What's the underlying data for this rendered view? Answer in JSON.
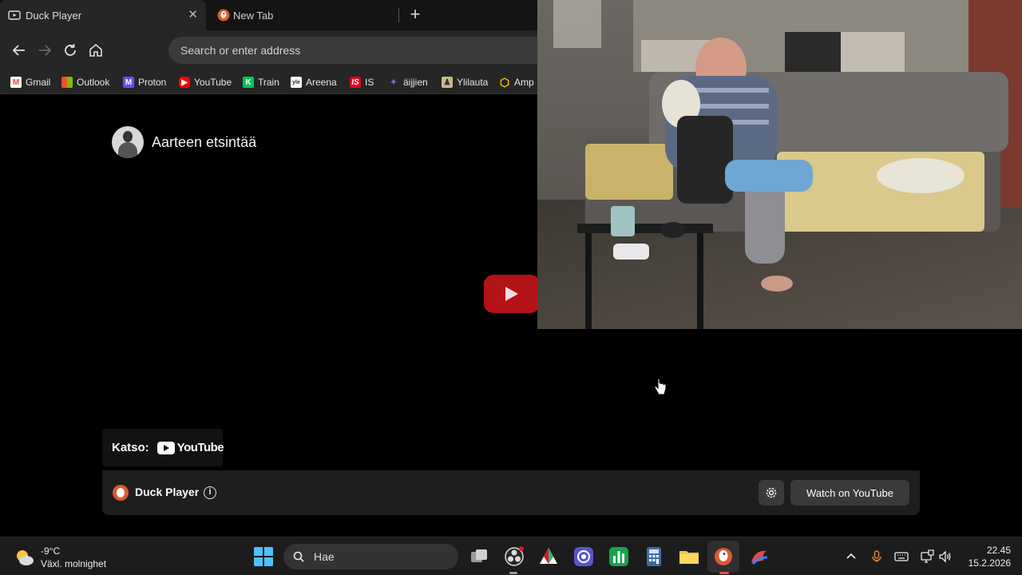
{
  "browser": {
    "tabs": [
      {
        "label": "Duck Player",
        "icon": "youtube-tab-icon",
        "active": true
      },
      {
        "label": "New Tab",
        "icon": "duckduckgo-icon",
        "active": false
      }
    ],
    "address_placeholder": "Search or enter address",
    "bookmarks": [
      {
        "label": "Gmail",
        "icon": "gmail-icon",
        "color": "#ea4335"
      },
      {
        "label": "Outlook",
        "icon": "windows-icon",
        "color": "#0078d4"
      },
      {
        "label": "Proton",
        "icon": "proton-icon",
        "color": "#6d4aff"
      },
      {
        "label": "YouTube",
        "icon": "youtube-icon",
        "color": "#ff0000"
      },
      {
        "label": "Train",
        "icon": "kiwi-icon",
        "color": "#00c853"
      },
      {
        "label": "Areena",
        "icon": "yle-icon",
        "color": "#222222"
      },
      {
        "label": "IS",
        "icon": "is-icon",
        "color": "#e3001b"
      },
      {
        "label": "äijjien",
        "icon": "figure-icon",
        "color": "#7a6cff"
      },
      {
        "label": "Ylilauta",
        "icon": "ylilauta-icon",
        "color": "#c9b98a"
      },
      {
        "label": "Amp",
        "icon": "hexagon-icon",
        "color": "#ffc400"
      }
    ]
  },
  "video": {
    "channel_name": "Aarteen etsintää"
  },
  "katso": {
    "label": "Katso:",
    "brand": "YouTube"
  },
  "duck_player": {
    "title": "Duck Player",
    "info": "i",
    "watch_label": "Watch on YouTube"
  },
  "taskbar": {
    "weather_temp": "-9°C",
    "weather_desc": "Växl. molnighet",
    "search_placeholder": "Hae",
    "time": "22.45",
    "date": "15.2.2026"
  },
  "colors": {
    "accent": "#de5833",
    "youtube_red": "#b31217"
  }
}
